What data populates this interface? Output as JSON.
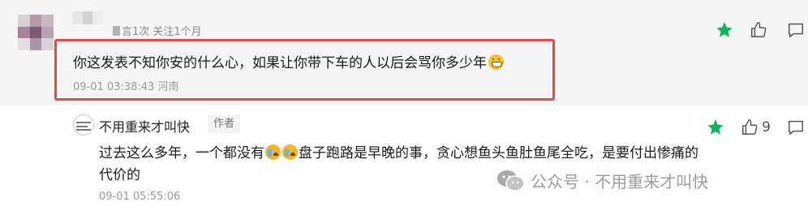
{
  "comment1": {
    "meta": "言1次  关注1个月",
    "text": "你这发表不知你安的什么心，如果让你带下车的人以后会骂你多少年",
    "emoji": "grin-emoji",
    "datetime": "09-01 03:38:43",
    "location": "河南",
    "like_count": "",
    "highlight_color": "#e8474c"
  },
  "reply": {
    "author_name": "不用重来才叫快",
    "author_tag": "作者",
    "text_part1": "过去这么多年，一个都没有",
    "text_part2": "盘子跑路是早晚的事，贪心想鱼头鱼肚鱼尾全吃，是要付出惨痛的代价的",
    "emoji": "sob-emoji",
    "datetime": "09-01 05:55:06",
    "like_count": "9"
  },
  "icons": {
    "star": "star-icon",
    "thumbs_up": "thumbs-up-icon",
    "comment": "comment-bubble-icon",
    "wechat": "wechat-icon",
    "accent_green": "#13b35b"
  },
  "watermark": {
    "text": "公众号 · 不用重来才叫快"
  }
}
